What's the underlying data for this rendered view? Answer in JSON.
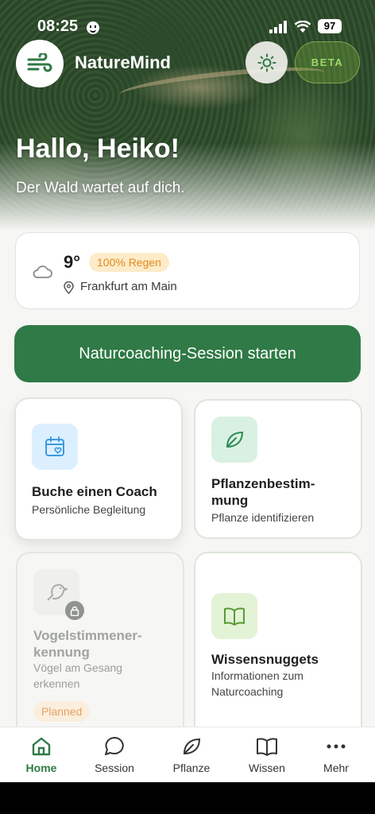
{
  "status_bar": {
    "time": "08:25",
    "battery": "97"
  },
  "header": {
    "app_name": "NatureMind",
    "beta_label": "BETA"
  },
  "hero": {
    "greeting": "Hallo, Heiko!",
    "subtitle": "Der Wald wartet auf dich."
  },
  "weather": {
    "temperature": "9°",
    "rain_badge": "100% Regen",
    "location": "Frankfurt am Main"
  },
  "cta": {
    "label": "Naturcoaching-Session starten"
  },
  "tiles": [
    {
      "title": "Buche einen Coach",
      "description": "Persönliche Begleitung",
      "icon": "calendar-heart-icon"
    },
    {
      "title": "Pflanzenbestim-\nmung",
      "description": "Pflanze identifizieren",
      "icon": "leaf-icon"
    },
    {
      "title": "Vogelstimmener-\nkennung",
      "description": "Vögel am Gesang\nerkennen",
      "icon": "bird-icon",
      "badge": "Planned"
    },
    {
      "title": "Wissensnuggets",
      "description": "Informationen zum\nNaturcoaching",
      "icon": "book-icon"
    }
  ],
  "tabbar": {
    "items": [
      {
        "label": "Home",
        "icon": "home-icon",
        "active": true
      },
      {
        "label": "Session",
        "icon": "chat-bubble-icon"
      },
      {
        "label": "Pflanze",
        "icon": "leaf-icon"
      },
      {
        "label": "Wissen",
        "icon": "book-icon"
      },
      {
        "label": "Mehr",
        "icon": "more-dots-icon"
      }
    ]
  },
  "colors": {
    "primary": "#2f7a46",
    "rain_badge": "#e08a1e",
    "beta": "#9bd86a"
  }
}
